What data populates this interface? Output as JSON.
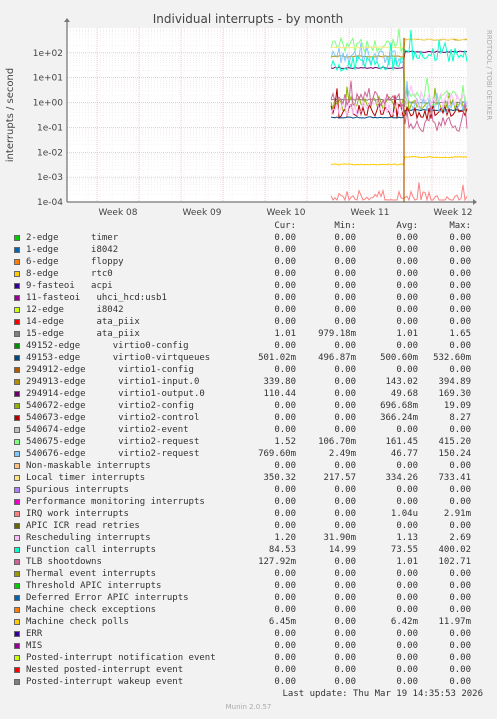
{
  "chart_data": {
    "type": "line",
    "title": "Individual interrupts - by month",
    "ylabel": "interrupts / second",
    "side_label": "RRDTOOL / TOBI OETIKER",
    "y_scale": "log",
    "ylim": [
      0.0001,
      1000
    ],
    "y_ticks": [
      "1e+02",
      "1e+01",
      "1e+00",
      "1e-01",
      "1e-02",
      "1e-03",
      "1e-04"
    ],
    "x_ticks": [
      "Week 08",
      "Week 09",
      "Week 10",
      "Week 11",
      "Week 12"
    ],
    "grid": true,
    "columns": [
      "Cur:",
      "Min:",
      "Avg:",
      "Max:"
    ],
    "series": [
      {
        "name": "2-edge      timer",
        "color": "#00cc00",
        "cur": "0.00",
        "min": "0.00",
        "avg": "0.00",
        "max": "0.00"
      },
      {
        "name": "1-edge      i8042",
        "color": "#0066b3",
        "cur": "0.00",
        "min": "0.00",
        "avg": "0.00",
        "max": "0.00"
      },
      {
        "name": "6-edge      floppy",
        "color": "#ff8000",
        "cur": "0.00",
        "min": "0.00",
        "avg": "0.00",
        "max": "0.00"
      },
      {
        "name": "8-edge      rtc0",
        "color": "#ffcc00",
        "cur": "0.00",
        "min": "0.00",
        "avg": "0.00",
        "max": "0.00"
      },
      {
        "name": "9-fasteoi   acpi",
        "color": "#330099",
        "cur": "0.00",
        "min": "0.00",
        "avg": "0.00",
        "max": "0.00"
      },
      {
        "name": "11-fasteoi   uhci_hcd:usb1",
        "color": "#990099",
        "cur": "0.00",
        "min": "0.00",
        "avg": "0.00",
        "max": "0.00"
      },
      {
        "name": "12-edge      i8042",
        "color": "#ccff00",
        "cur": "0.00",
        "min": "0.00",
        "avg": "0.00",
        "max": "0.00"
      },
      {
        "name": "14-edge      ata_piix",
        "color": "#ff0000",
        "cur": "0.00",
        "min": "0.00",
        "avg": "0.00",
        "max": "0.00"
      },
      {
        "name": "15-edge      ata_piix",
        "color": "#808080",
        "cur": "1.01",
        "min": "979.18m",
        "avg": "1.01",
        "max": "1.65"
      },
      {
        "name": "49152-edge      virtio0-config",
        "color": "#008f00",
        "cur": "0.00",
        "min": "0.00",
        "avg": "0.00",
        "max": "0.00"
      },
      {
        "name": "49153-edge      virtio0-virtqueues",
        "color": "#00487d",
        "cur": "501.02m",
        "min": "496.87m",
        "avg": "500.60m",
        "max": "532.60m"
      },
      {
        "name": "294912-edge      virtio1-config",
        "color": "#b35a00",
        "cur": "0.00",
        "min": "0.00",
        "avg": "0.00",
        "max": "0.00"
      },
      {
        "name": "294913-edge      virtio1-input.0",
        "color": "#b38f00",
        "cur": "339.80",
        "min": "0.00",
        "avg": "143.02",
        "max": "394.89"
      },
      {
        "name": "294914-edge      virtio1-output.0",
        "color": "#6b006b",
        "cur": "110.44",
        "min": "0.00",
        "avg": "49.68",
        "max": "169.30"
      },
      {
        "name": "540672-edge      virtio2-config",
        "color": "#8fb300",
        "cur": "0.00",
        "min": "0.00",
        "avg": "696.68m",
        "max": "19.09"
      },
      {
        "name": "540673-edge      virtio2-control",
        "color": "#b30000",
        "cur": "0.00",
        "min": "0.00",
        "avg": "366.24m",
        "max": "8.27"
      },
      {
        "name": "540674-edge      virtio2-event",
        "color": "#bebebe",
        "cur": "0.00",
        "min": "0.00",
        "avg": "0.00",
        "max": "0.00"
      },
      {
        "name": "540675-edge      virtio2-request",
        "color": "#80ff80",
        "cur": "1.52",
        "min": "106.70m",
        "avg": "161.45",
        "max": "415.20"
      },
      {
        "name": "540676-edge      virtio2-request",
        "color": "#80c9ff",
        "cur": "769.60m",
        "min": "2.49m",
        "avg": "46.77",
        "max": "150.24"
      },
      {
        "name": "Non-maskable interrupts",
        "color": "#ffc080",
        "cur": "0.00",
        "min": "0.00",
        "avg": "0.00",
        "max": "0.00"
      },
      {
        "name": "Local timer interrupts",
        "color": "#ffe680",
        "cur": "350.32",
        "min": "217.57",
        "avg": "334.26",
        "max": "733.41"
      },
      {
        "name": "Spurious interrupts",
        "color": "#aa80ff",
        "cur": "0.00",
        "min": "0.00",
        "avg": "0.00",
        "max": "0.00"
      },
      {
        "name": "Performance monitoring interrupts",
        "color": "#ee00cc",
        "cur": "0.00",
        "min": "0.00",
        "avg": "0.00",
        "max": "0.00"
      },
      {
        "name": "IRQ work interrupts",
        "color": "#ff8080",
        "cur": "0.00",
        "min": "0.00",
        "avg": "1.04u",
        "max": "2.91m"
      },
      {
        "name": "APIC ICR read retries",
        "color": "#666600",
        "cur": "0.00",
        "min": "0.00",
        "avg": "0.00",
        "max": "0.00"
      },
      {
        "name": "Rescheduling interrupts",
        "color": "#ffbfff",
        "cur": "1.20",
        "min": "31.90m",
        "avg": "1.13",
        "max": "2.69"
      },
      {
        "name": "Function call interrupts",
        "color": "#00ffcc",
        "cur": "84.53",
        "min": "14.99",
        "avg": "73.55",
        "max": "400.02"
      },
      {
        "name": "TLB shootdowns",
        "color": "#cc6699",
        "cur": "127.92m",
        "min": "0.00",
        "avg": "1.01",
        "max": "102.71"
      },
      {
        "name": "Thermal event interrupts",
        "color": "#999900",
        "cur": "0.00",
        "min": "0.00",
        "avg": "0.00",
        "max": "0.00"
      },
      {
        "name": "Threshold APIC interrupts",
        "color": "#00cc00",
        "cur": "0.00",
        "min": "0.00",
        "avg": "0.00",
        "max": "0.00"
      },
      {
        "name": "Deferred Error APIC interrupts",
        "color": "#0066b3",
        "cur": "0.00",
        "min": "0.00",
        "avg": "0.00",
        "max": "0.00"
      },
      {
        "name": "Machine check exceptions",
        "color": "#ff8000",
        "cur": "0.00",
        "min": "0.00",
        "avg": "0.00",
        "max": "0.00"
      },
      {
        "name": "Machine check polls",
        "color": "#ffcc00",
        "cur": "6.45m",
        "min": "0.00",
        "avg": "6.42m",
        "max": "11.97m"
      },
      {
        "name": "ERR",
        "color": "#330099",
        "cur": "0.00",
        "min": "0.00",
        "avg": "0.00",
        "max": "0.00"
      },
      {
        "name": "MIS",
        "color": "#990099",
        "cur": "0.00",
        "min": "0.00",
        "avg": "0.00",
        "max": "0.00"
      },
      {
        "name": "Posted-interrupt notification event",
        "color": "#ccff00",
        "cur": "0.00",
        "min": "0.00",
        "avg": "0.00",
        "max": "0.00"
      },
      {
        "name": "Nested posted-interrupt event",
        "color": "#ff0000",
        "cur": "0.00",
        "min": "0.00",
        "avg": "0.00",
        "max": "0.00"
      },
      {
        "name": "Posted-interrupt wakeup event",
        "color": "#808080",
        "cur": "0.00",
        "min": "0.00",
        "avg": "0.00",
        "max": "0.00"
      }
    ]
  },
  "footer": {
    "last_update": "Last update: Thu Mar 19 14:35:53 2026",
    "munin_version": "Munin 2.0.57"
  }
}
